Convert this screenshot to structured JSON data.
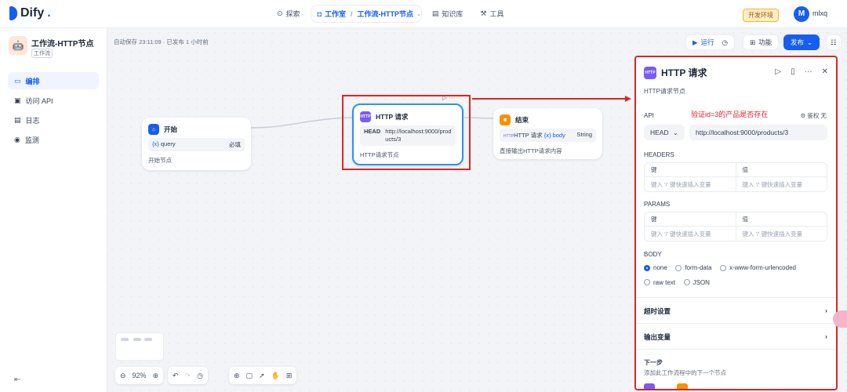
{
  "header": {
    "logo_text": "Dify",
    "nav": [
      {
        "label": "探索",
        "icon": "explore-icon"
      },
      {
        "label": "工作室",
        "icon": "robot-icon"
      },
      {
        "label": "工作流-HTTP节点",
        "icon": "chevron-down-icon"
      },
      {
        "label": "知识库",
        "icon": "book-icon"
      },
      {
        "label": "工具",
        "icon": "tool-icon"
      }
    ],
    "env_badge": "开发环境",
    "avatar_letter": "M",
    "username": "mlxq"
  },
  "sidebar": {
    "app_name": "工作流-HTTP节点",
    "app_type": "工作流",
    "items": [
      {
        "label": "编排",
        "icon": "layout-icon"
      },
      {
        "label": "访问 API",
        "icon": "terminal-icon"
      },
      {
        "label": "日志",
        "icon": "file-icon"
      },
      {
        "label": "监测",
        "icon": "monitor-icon"
      }
    ],
    "collapse_icon": "collapse-icon"
  },
  "canvas": {
    "autosave": "自动保存 23:11:09 · 已发布 1 小时前",
    "run_label": "运行",
    "features_label": "功能",
    "publish_label": "发布",
    "zoom": "92%",
    "nodes": {
      "start": {
        "title": "开始",
        "field": "query",
        "field_tag": "必填",
        "desc": "开始节点"
      },
      "http": {
        "title": "HTTP 请求",
        "method": "HEAD",
        "url": "http://localhost:9000/products/3",
        "desc": "HTTP请求节点"
      },
      "end": {
        "title": "结束",
        "field": "HTTP 请求",
        "field_var": "body",
        "field_type": "String",
        "desc": "直接输出HTTP请求内容"
      }
    }
  },
  "panel": {
    "title": "HTTP 请求",
    "desc": "HTTP请求节点",
    "api_label": "API",
    "annotation": "验证id=3的产品是否存在",
    "auth_label": "鉴权 无",
    "method": "HEAD",
    "url": "http://localhost:9000/products/3",
    "headers_label": "HEADERS",
    "params_label": "PARAMS",
    "key_header": "键",
    "value_header": "值",
    "placeholder": "键入 '/' 键快速插入变量",
    "body_label": "BODY",
    "body_options": [
      "none",
      "form-data",
      "x-www-form-urlencoded",
      "raw text",
      "JSON"
    ],
    "body_selected": "none",
    "timeout_label": "超时设置",
    "output_label": "输出变量",
    "next_label": "下一步",
    "next_desc": "添加此工作流程中的下一个节点"
  }
}
